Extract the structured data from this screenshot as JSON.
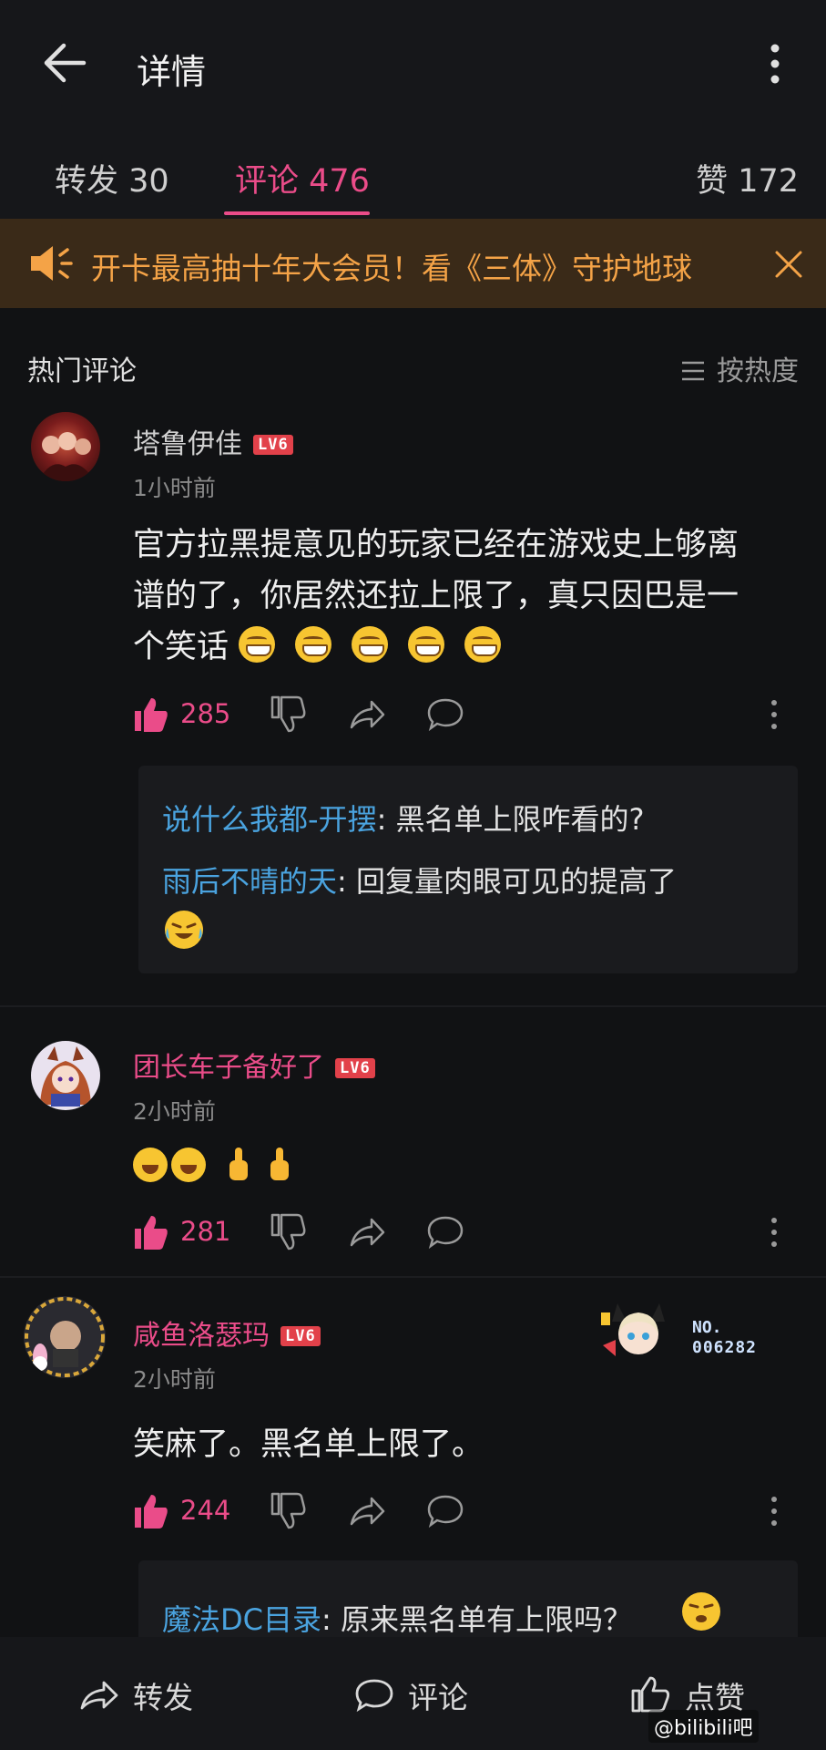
{
  "header": {
    "title": "详情"
  },
  "tabs": {
    "repost": "转发 30",
    "comments": "评论 476",
    "likes": "赞 172"
  },
  "banner": {
    "text": "开卡最高抽十年大会员！看《三体》守护地球"
  },
  "section": {
    "title": "热门评论",
    "sort": "按热度"
  },
  "comments": [
    {
      "user": "塔鲁伊佳",
      "level": "LV6",
      "time": "1小时前",
      "text_lines": [
        "官方拉黑提意见的玩家已经在游戏史上够离",
        "谱的了，你居然还拉上限了，真只因巴是一",
        "个笑话"
      ],
      "likes": "285",
      "replies": [
        {
          "user": "说什么我都-开摆",
          "text": ": 黑名单上限咋看的?"
        },
        {
          "user": "雨后不晴的天",
          "text": ": 回复量肉眼可见的提高了"
        }
      ]
    },
    {
      "user": "团长车子备好了",
      "level": "LV6",
      "time": "2小时前",
      "text_lines": [
        ""
      ],
      "likes": "281",
      "replies": []
    },
    {
      "user": "咸鱼洛瑟玛",
      "level": "LV6",
      "time": "2小时前",
      "text_lines": [
        "笑麻了。黑名单上限了。"
      ],
      "likes": "244",
      "badge_no": "NO.",
      "badge_num": "006282",
      "replies": [
        {
          "user": "魔法DC目录",
          "text": ": 原来黑名单有上限吗？"
        }
      ]
    }
  ],
  "bottom": {
    "repost": "转发",
    "comment": "评论",
    "like": "点赞"
  },
  "watermark": "@bilibili吧",
  "colors": {
    "accent_pink": "#ea4c89",
    "reply_name_blue": "#4aa3df",
    "banner_text": "#f4a347",
    "level_badge": "#e2414a"
  }
}
